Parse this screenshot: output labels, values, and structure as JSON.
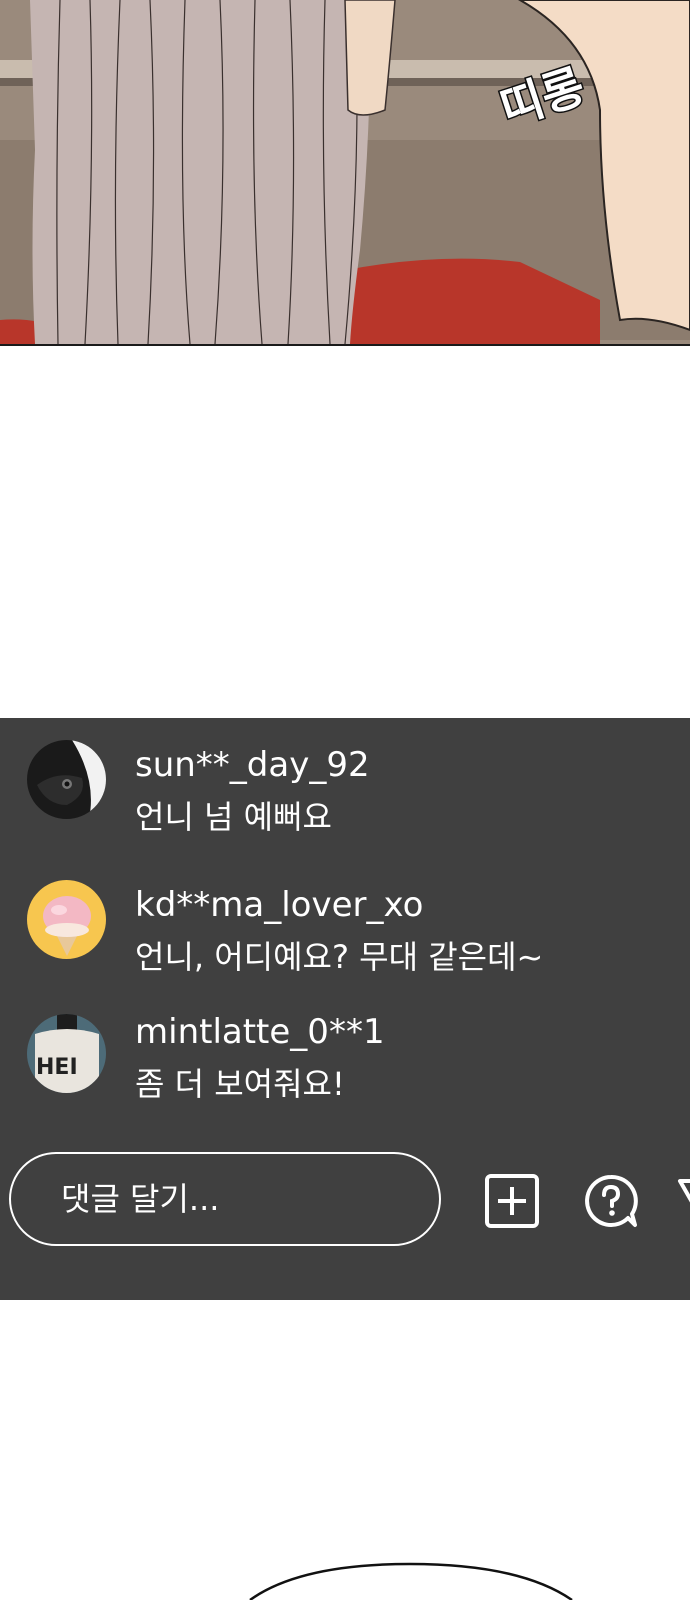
{
  "panel": {
    "sound_effect": "띠롱"
  },
  "comments": [
    {
      "username": "sun**_day_92",
      "message": "언니 넘 예뻐요",
      "avatar_icon": "dog-avatar"
    },
    {
      "username": "kd**ma_lover_xo",
      "message": "언니, 어디예요? 무대 같은데~",
      "avatar_icon": "ice-cream-avatar"
    },
    {
      "username": "mintlatte_0**1",
      "message": "좀 더 보여줘요!",
      "avatar_icon": "person-avatar"
    }
  ],
  "comment_input": {
    "placeholder": "댓글 달기..."
  },
  "actions": [
    {
      "icon": "add-square-icon"
    },
    {
      "icon": "question-bubble-icon"
    },
    {
      "icon": "send-icon"
    }
  ],
  "colors": {
    "chat_background": "#404040",
    "text": "#ffffff"
  }
}
